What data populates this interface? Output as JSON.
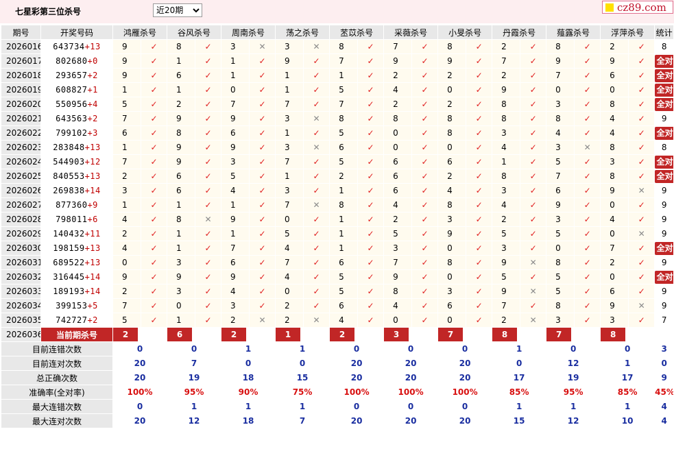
{
  "page": {
    "title": "七星彩第三位杀号",
    "period_select": "近20期",
    "logo": "cz89.com"
  },
  "table": {
    "headers": [
      "期号",
      "开奖号码",
      "鸿雁杀号",
      "谷风杀号",
      "周南杀号",
      "荡之杀号",
      "苤苡杀号",
      "采薇杀号",
      "小旻杀号",
      "丹霞杀号",
      "薤露杀号",
      "浮萍杀号",
      "统计"
    ],
    "all_correct_label": "全对",
    "rows": [
      {
        "p": "2026016",
        "n": "643734",
        "d": "+13",
        "k": [
          [
            9,
            1
          ],
          [
            8,
            1
          ],
          [
            3,
            0
          ],
          [
            3,
            0
          ],
          [
            8,
            1
          ],
          [
            7,
            1
          ],
          [
            8,
            1
          ],
          [
            2,
            1
          ],
          [
            8,
            1
          ],
          [
            2,
            1
          ]
        ],
        "s": "8"
      },
      {
        "p": "2026017",
        "n": "802680",
        "d": "+0",
        "k": [
          [
            9,
            1
          ],
          [
            1,
            1
          ],
          [
            1,
            1
          ],
          [
            9,
            1
          ],
          [
            7,
            1
          ],
          [
            9,
            1
          ],
          [
            9,
            1
          ],
          [
            7,
            1
          ],
          [
            9,
            1
          ],
          [
            9,
            1
          ]
        ],
        "s": "全对"
      },
      {
        "p": "2026018",
        "n": "293657",
        "d": "+2",
        "k": [
          [
            9,
            1
          ],
          [
            6,
            1
          ],
          [
            1,
            1
          ],
          [
            1,
            1
          ],
          [
            1,
            1
          ],
          [
            2,
            1
          ],
          [
            2,
            1
          ],
          [
            2,
            1
          ],
          [
            7,
            1
          ],
          [
            6,
            1
          ]
        ],
        "s": "全对"
      },
      {
        "p": "2026019",
        "n": "608827",
        "d": "+1",
        "k": [
          [
            1,
            1
          ],
          [
            1,
            1
          ],
          [
            0,
            1
          ],
          [
            1,
            1
          ],
          [
            5,
            1
          ],
          [
            4,
            1
          ],
          [
            0,
            1
          ],
          [
            9,
            1
          ],
          [
            0,
            1
          ],
          [
            0,
            1
          ]
        ],
        "s": "全对"
      },
      {
        "p": "2026020",
        "n": "550956",
        "d": "+4",
        "k": [
          [
            5,
            1
          ],
          [
            2,
            1
          ],
          [
            7,
            1
          ],
          [
            7,
            1
          ],
          [
            7,
            1
          ],
          [
            2,
            1
          ],
          [
            2,
            1
          ],
          [
            8,
            1
          ],
          [
            3,
            1
          ],
          [
            8,
            1
          ]
        ],
        "s": "全对"
      },
      {
        "p": "2026021",
        "n": "643563",
        "d": "+2",
        "k": [
          [
            7,
            1
          ],
          [
            9,
            1
          ],
          [
            9,
            1
          ],
          [
            3,
            0
          ],
          [
            8,
            1
          ],
          [
            8,
            1
          ],
          [
            8,
            1
          ],
          [
            8,
            1
          ],
          [
            8,
            1
          ],
          [
            4,
            1
          ]
        ],
        "s": "9"
      },
      {
        "p": "2026022",
        "n": "799102",
        "d": "+3",
        "k": [
          [
            6,
            1
          ],
          [
            8,
            1
          ],
          [
            6,
            1
          ],
          [
            1,
            1
          ],
          [
            5,
            1
          ],
          [
            0,
            1
          ],
          [
            8,
            1
          ],
          [
            3,
            1
          ],
          [
            4,
            1
          ],
          [
            4,
            1
          ]
        ],
        "s": "全对"
      },
      {
        "p": "2026023",
        "n": "283848",
        "d": "+13",
        "k": [
          [
            1,
            1
          ],
          [
            9,
            1
          ],
          [
            9,
            1
          ],
          [
            3,
            0
          ],
          [
            6,
            1
          ],
          [
            0,
            1
          ],
          [
            0,
            1
          ],
          [
            4,
            1
          ],
          [
            3,
            0
          ],
          [
            8,
            1
          ]
        ],
        "s": "8"
      },
      {
        "p": "2026024",
        "n": "544903",
        "d": "+12",
        "k": [
          [
            7,
            1
          ],
          [
            9,
            1
          ],
          [
            3,
            1
          ],
          [
            7,
            1
          ],
          [
            5,
            1
          ],
          [
            6,
            1
          ],
          [
            6,
            1
          ],
          [
            1,
            1
          ],
          [
            5,
            1
          ],
          [
            3,
            1
          ]
        ],
        "s": "全对"
      },
      {
        "p": "2026025",
        "n": "840553",
        "d": "+13",
        "k": [
          [
            2,
            1
          ],
          [
            6,
            1
          ],
          [
            5,
            1
          ],
          [
            1,
            1
          ],
          [
            2,
            1
          ],
          [
            6,
            1
          ],
          [
            2,
            1
          ],
          [
            8,
            1
          ],
          [
            7,
            1
          ],
          [
            8,
            1
          ]
        ],
        "s": "全对"
      },
      {
        "p": "2026026",
        "n": "269838",
        "d": "+14",
        "k": [
          [
            3,
            1
          ],
          [
            6,
            1
          ],
          [
            4,
            1
          ],
          [
            3,
            1
          ],
          [
            1,
            1
          ],
          [
            6,
            1
          ],
          [
            4,
            1
          ],
          [
            3,
            1
          ],
          [
            6,
            1
          ],
          [
            9,
            0
          ]
        ],
        "s": "9"
      },
      {
        "p": "2026027",
        "n": "877360",
        "d": "+9",
        "k": [
          [
            1,
            1
          ],
          [
            1,
            1
          ],
          [
            1,
            1
          ],
          [
            7,
            0
          ],
          [
            8,
            1
          ],
          [
            4,
            1
          ],
          [
            8,
            1
          ],
          [
            4,
            1
          ],
          [
            9,
            1
          ],
          [
            0,
            1
          ]
        ],
        "s": "9"
      },
      {
        "p": "2026028",
        "n": "798011",
        "d": "+6",
        "k": [
          [
            4,
            1
          ],
          [
            8,
            0
          ],
          [
            9,
            1
          ],
          [
            0,
            1
          ],
          [
            1,
            1
          ],
          [
            2,
            1
          ],
          [
            3,
            1
          ],
          [
            2,
            1
          ],
          [
            3,
            1
          ],
          [
            4,
            1
          ]
        ],
        "s": "9"
      },
      {
        "p": "2026029",
        "n": "140432",
        "d": "+11",
        "k": [
          [
            2,
            1
          ],
          [
            1,
            1
          ],
          [
            1,
            1
          ],
          [
            5,
            1
          ],
          [
            1,
            1
          ],
          [
            5,
            1
          ],
          [
            9,
            1
          ],
          [
            5,
            1
          ],
          [
            5,
            1
          ],
          [
            0,
            0
          ]
        ],
        "s": "9"
      },
      {
        "p": "2026030",
        "n": "198159",
        "d": "+13",
        "k": [
          [
            4,
            1
          ],
          [
            1,
            1
          ],
          [
            7,
            1
          ],
          [
            4,
            1
          ],
          [
            1,
            1
          ],
          [
            3,
            1
          ],
          [
            0,
            1
          ],
          [
            3,
            1
          ],
          [
            0,
            1
          ],
          [
            7,
            1
          ]
        ],
        "s": "全对"
      },
      {
        "p": "2026031",
        "n": "689522",
        "d": "+13",
        "k": [
          [
            0,
            1
          ],
          [
            3,
            1
          ],
          [
            6,
            1
          ],
          [
            7,
            1
          ],
          [
            6,
            1
          ],
          [
            7,
            1
          ],
          [
            8,
            1
          ],
          [
            9,
            0
          ],
          [
            8,
            1
          ],
          [
            2,
            1
          ]
        ],
        "s": "9"
      },
      {
        "p": "2026032",
        "n": "316445",
        "d": "+14",
        "k": [
          [
            9,
            1
          ],
          [
            9,
            1
          ],
          [
            9,
            1
          ],
          [
            4,
            1
          ],
          [
            5,
            1
          ],
          [
            9,
            1
          ],
          [
            0,
            1
          ],
          [
            5,
            1
          ],
          [
            5,
            1
          ],
          [
            0,
            1
          ]
        ],
        "s": "全对"
      },
      {
        "p": "2026033",
        "n": "189193",
        "d": "+14",
        "k": [
          [
            2,
            1
          ],
          [
            3,
            1
          ],
          [
            4,
            1
          ],
          [
            0,
            1
          ],
          [
            5,
            1
          ],
          [
            8,
            1
          ],
          [
            3,
            1
          ],
          [
            9,
            0
          ],
          [
            5,
            1
          ],
          [
            6,
            1
          ]
        ],
        "s": "9"
      },
      {
        "p": "2026034",
        "n": "399153",
        "d": "+5",
        "k": [
          [
            7,
            1
          ],
          [
            0,
            1
          ],
          [
            3,
            1
          ],
          [
            2,
            1
          ],
          [
            6,
            1
          ],
          [
            4,
            1
          ],
          [
            6,
            1
          ],
          [
            7,
            1
          ],
          [
            8,
            1
          ],
          [
            9,
            0
          ]
        ],
        "s": "9"
      },
      {
        "p": "2026035",
        "n": "742727",
        "d": "+2",
        "k": [
          [
            5,
            1
          ],
          [
            1,
            1
          ],
          [
            2,
            0
          ],
          [
            2,
            0
          ],
          [
            4,
            1
          ],
          [
            0,
            1
          ],
          [
            0,
            1
          ],
          [
            2,
            0
          ],
          [
            3,
            1
          ],
          [
            3,
            1
          ]
        ],
        "s": "7"
      }
    ],
    "current": {
      "period": "2026036",
      "label": "当前期杀号",
      "values": [
        "2",
        "6",
        "2",
        "1",
        "2",
        "3",
        "7",
        "8",
        "7",
        "8"
      ]
    },
    "stats": [
      {
        "label": "目前连错次数",
        "values": [
          "0",
          "0",
          "1",
          "1",
          "0",
          "0",
          "0",
          "1",
          "0",
          "0",
          "3"
        ]
      },
      {
        "label": "目前连对次数",
        "values": [
          "20",
          "7",
          "0",
          "0",
          "20",
          "20",
          "20",
          "0",
          "12",
          "1",
          "0"
        ]
      },
      {
        "label": "总正确次数",
        "values": [
          "20",
          "19",
          "18",
          "15",
          "20",
          "20",
          "20",
          "17",
          "19",
          "17",
          "9"
        ]
      },
      {
        "label": "准确率(全对率)",
        "rate": true,
        "values": [
          "100%",
          "95%",
          "90%",
          "75%",
          "100%",
          "100%",
          "100%",
          "85%",
          "95%",
          "85%",
          "45%"
        ]
      },
      {
        "label": "最大连错次数",
        "values": [
          "0",
          "1",
          "1",
          "1",
          "0",
          "0",
          "0",
          "1",
          "1",
          "1",
          "4"
        ]
      },
      {
        "label": "最大连对次数",
        "values": [
          "20",
          "12",
          "18",
          "7",
          "20",
          "20",
          "20",
          "15",
          "12",
          "10",
          "4"
        ]
      }
    ]
  }
}
